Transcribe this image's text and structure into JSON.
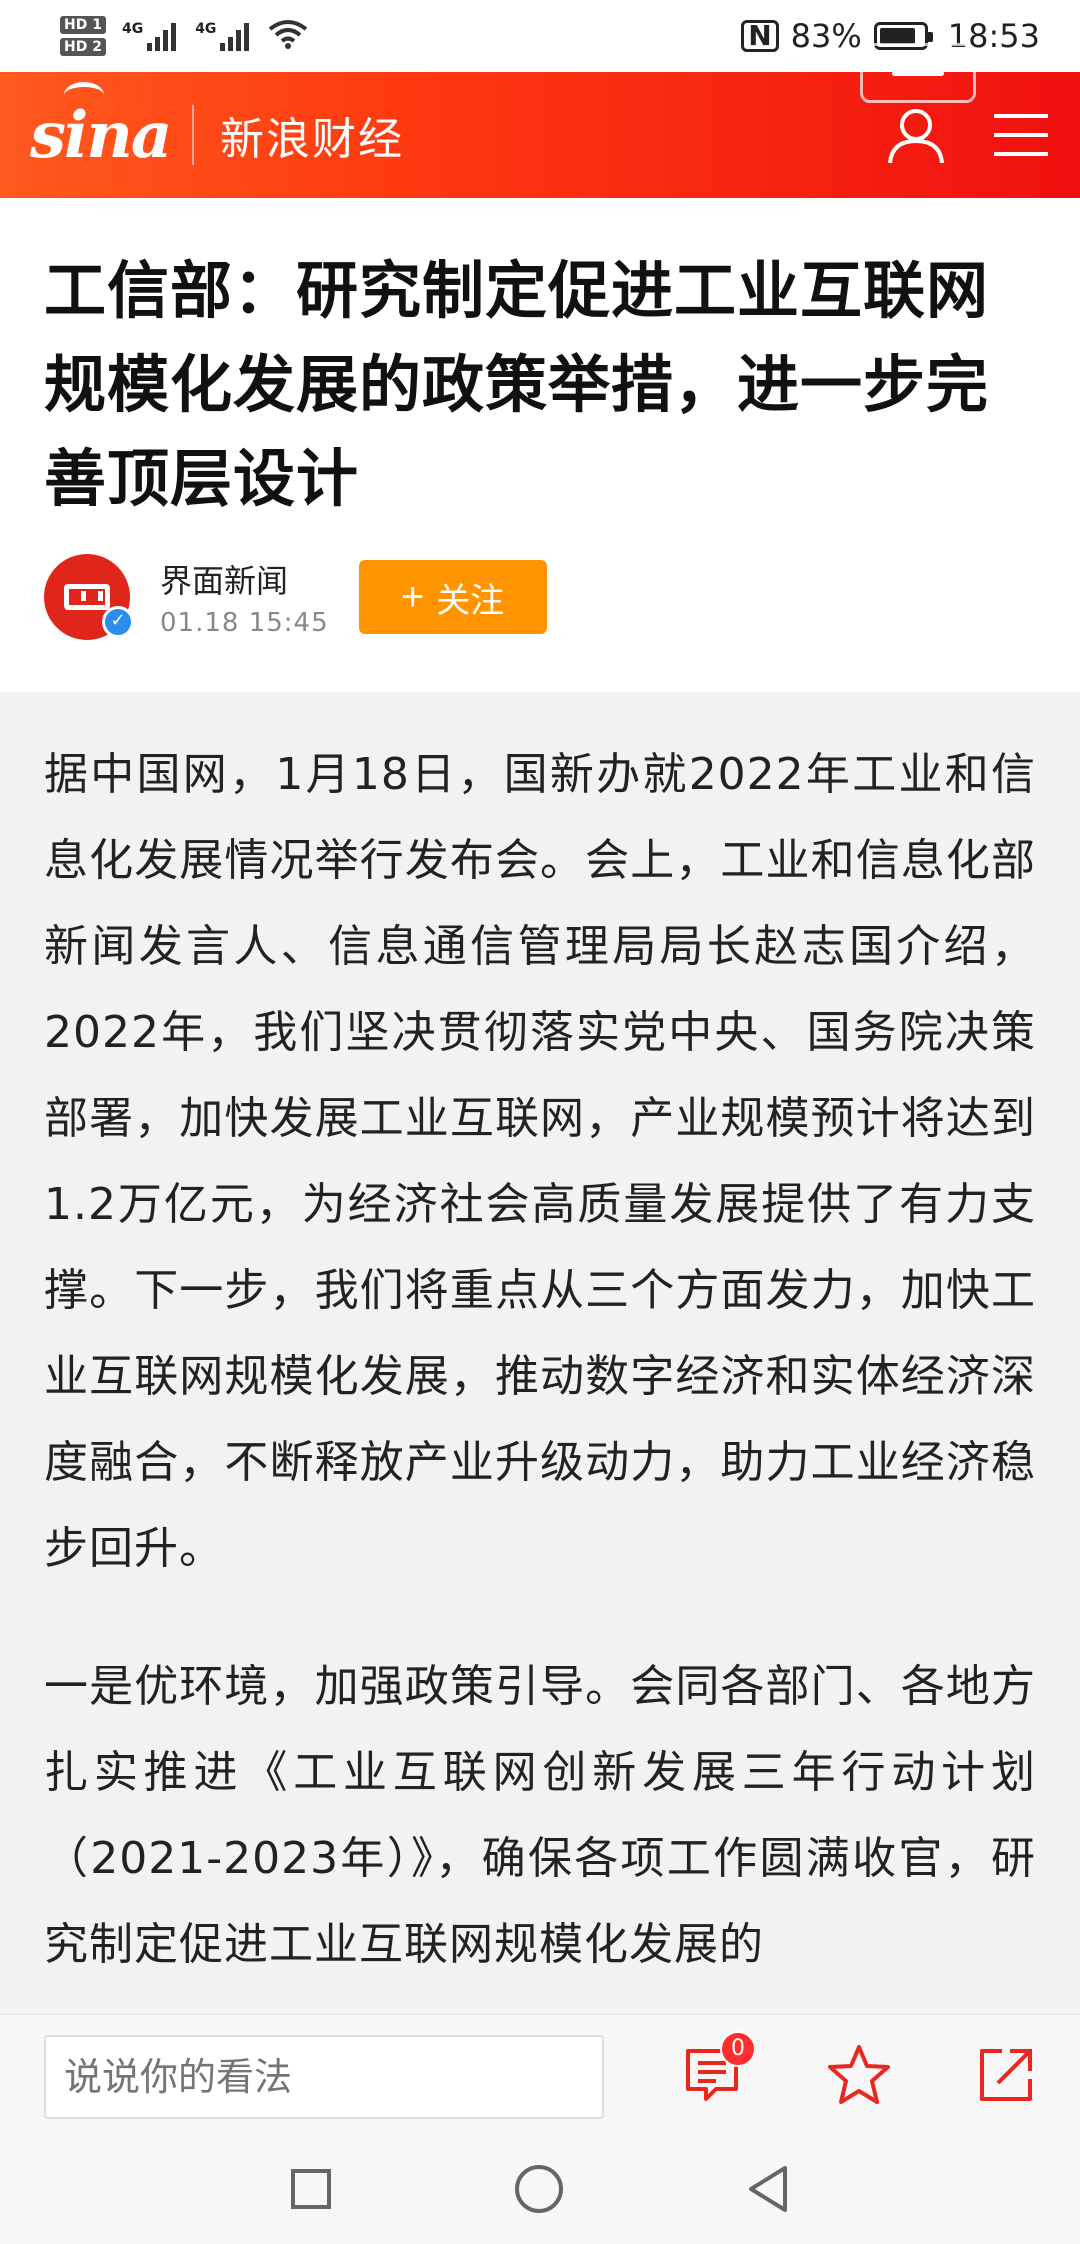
{
  "status_bar": {
    "sim1": "HD 1",
    "sim2": "HD 2",
    "network1": "4G",
    "network2": "4G",
    "battery_percent": "83%",
    "battery_level": 0.83,
    "time": "18:53"
  },
  "app_bar": {
    "logo": "sina",
    "title": "新浪财经",
    "icons": [
      "user-icon",
      "menu-icon",
      "minimize-icon"
    ]
  },
  "article": {
    "title": "工信部：研究制定促进工业互联网规模化发展的政策举措，进一步完善顶层设计",
    "author": "界面新闻",
    "time": "01.18 15:45",
    "follow_label": "关注",
    "paragraphs": [
      "据中国网，1月18日，国新办就2022年工业和信息化发展情况举行发布会。会上，工业和信息化部新闻发言人、信息通信管理局局长赵志国介绍，2022年，我们坚决贯彻落实党中央、国务院决策部署，加快发展工业互联网，产业规模预计将达到1.2万亿元，为经济社会高质量发展提供了有力支撑。下一步，我们将重点从三个方面发力，加快工业互联网规模化发展，推动数字经济和实体经济深度融合，不断释放产业升级动力，助力工业经济稳步回升。",
      "一是优环境，加强政策引导。会同各部门、各地方扎实推进《工业互联网创新发展三年行动计划（2021-2023年）》，确保各项工作圆满收官，研究制定促进工业互联网规模化发展的"
    ]
  },
  "comment_bar": {
    "placeholder": "说说你的看法",
    "comment_count": "0"
  },
  "colors": {
    "brand_red": "#f01010",
    "brand_orange": "#ff5a1f",
    "follow_orange": "#ff9400",
    "icon_red": "#e8281e"
  }
}
